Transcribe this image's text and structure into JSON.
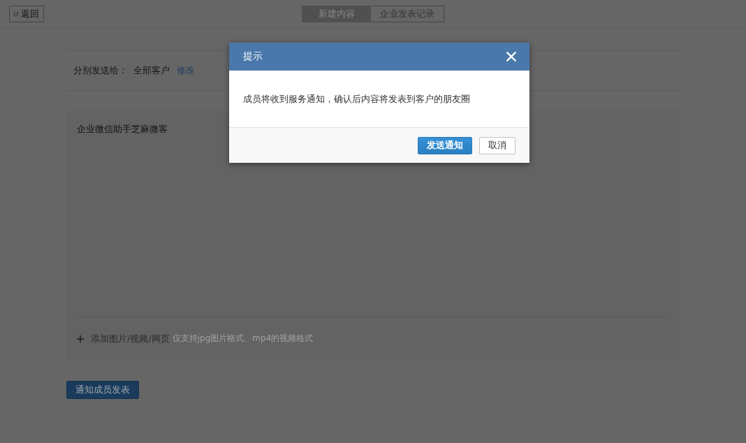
{
  "back_button": {
    "label": "返回"
  },
  "tabs": [
    {
      "label": "新建内容",
      "selected": true
    },
    {
      "label": "企业发表记录",
      "selected": false
    }
  ],
  "recipients": {
    "label": "分别发送给：",
    "value": "全部客户",
    "link": "修改"
  },
  "editor": {
    "value": "企业微信助手芝麻微客",
    "attach_label": "添加图片/视频/网页",
    "attach_hint": "仅支持jpg图片格式、mp4的视频格式"
  },
  "submit_button": {
    "label": "通知成员发表"
  },
  "dialog": {
    "title": "提示",
    "message": "成员将收到服务通知，确认后内容将发表到客户的朋友圈",
    "buttons": [
      {
        "label": "发送通知",
        "kind": "primary"
      },
      {
        "label": "取消",
        "kind": "default"
      }
    ]
  }
}
